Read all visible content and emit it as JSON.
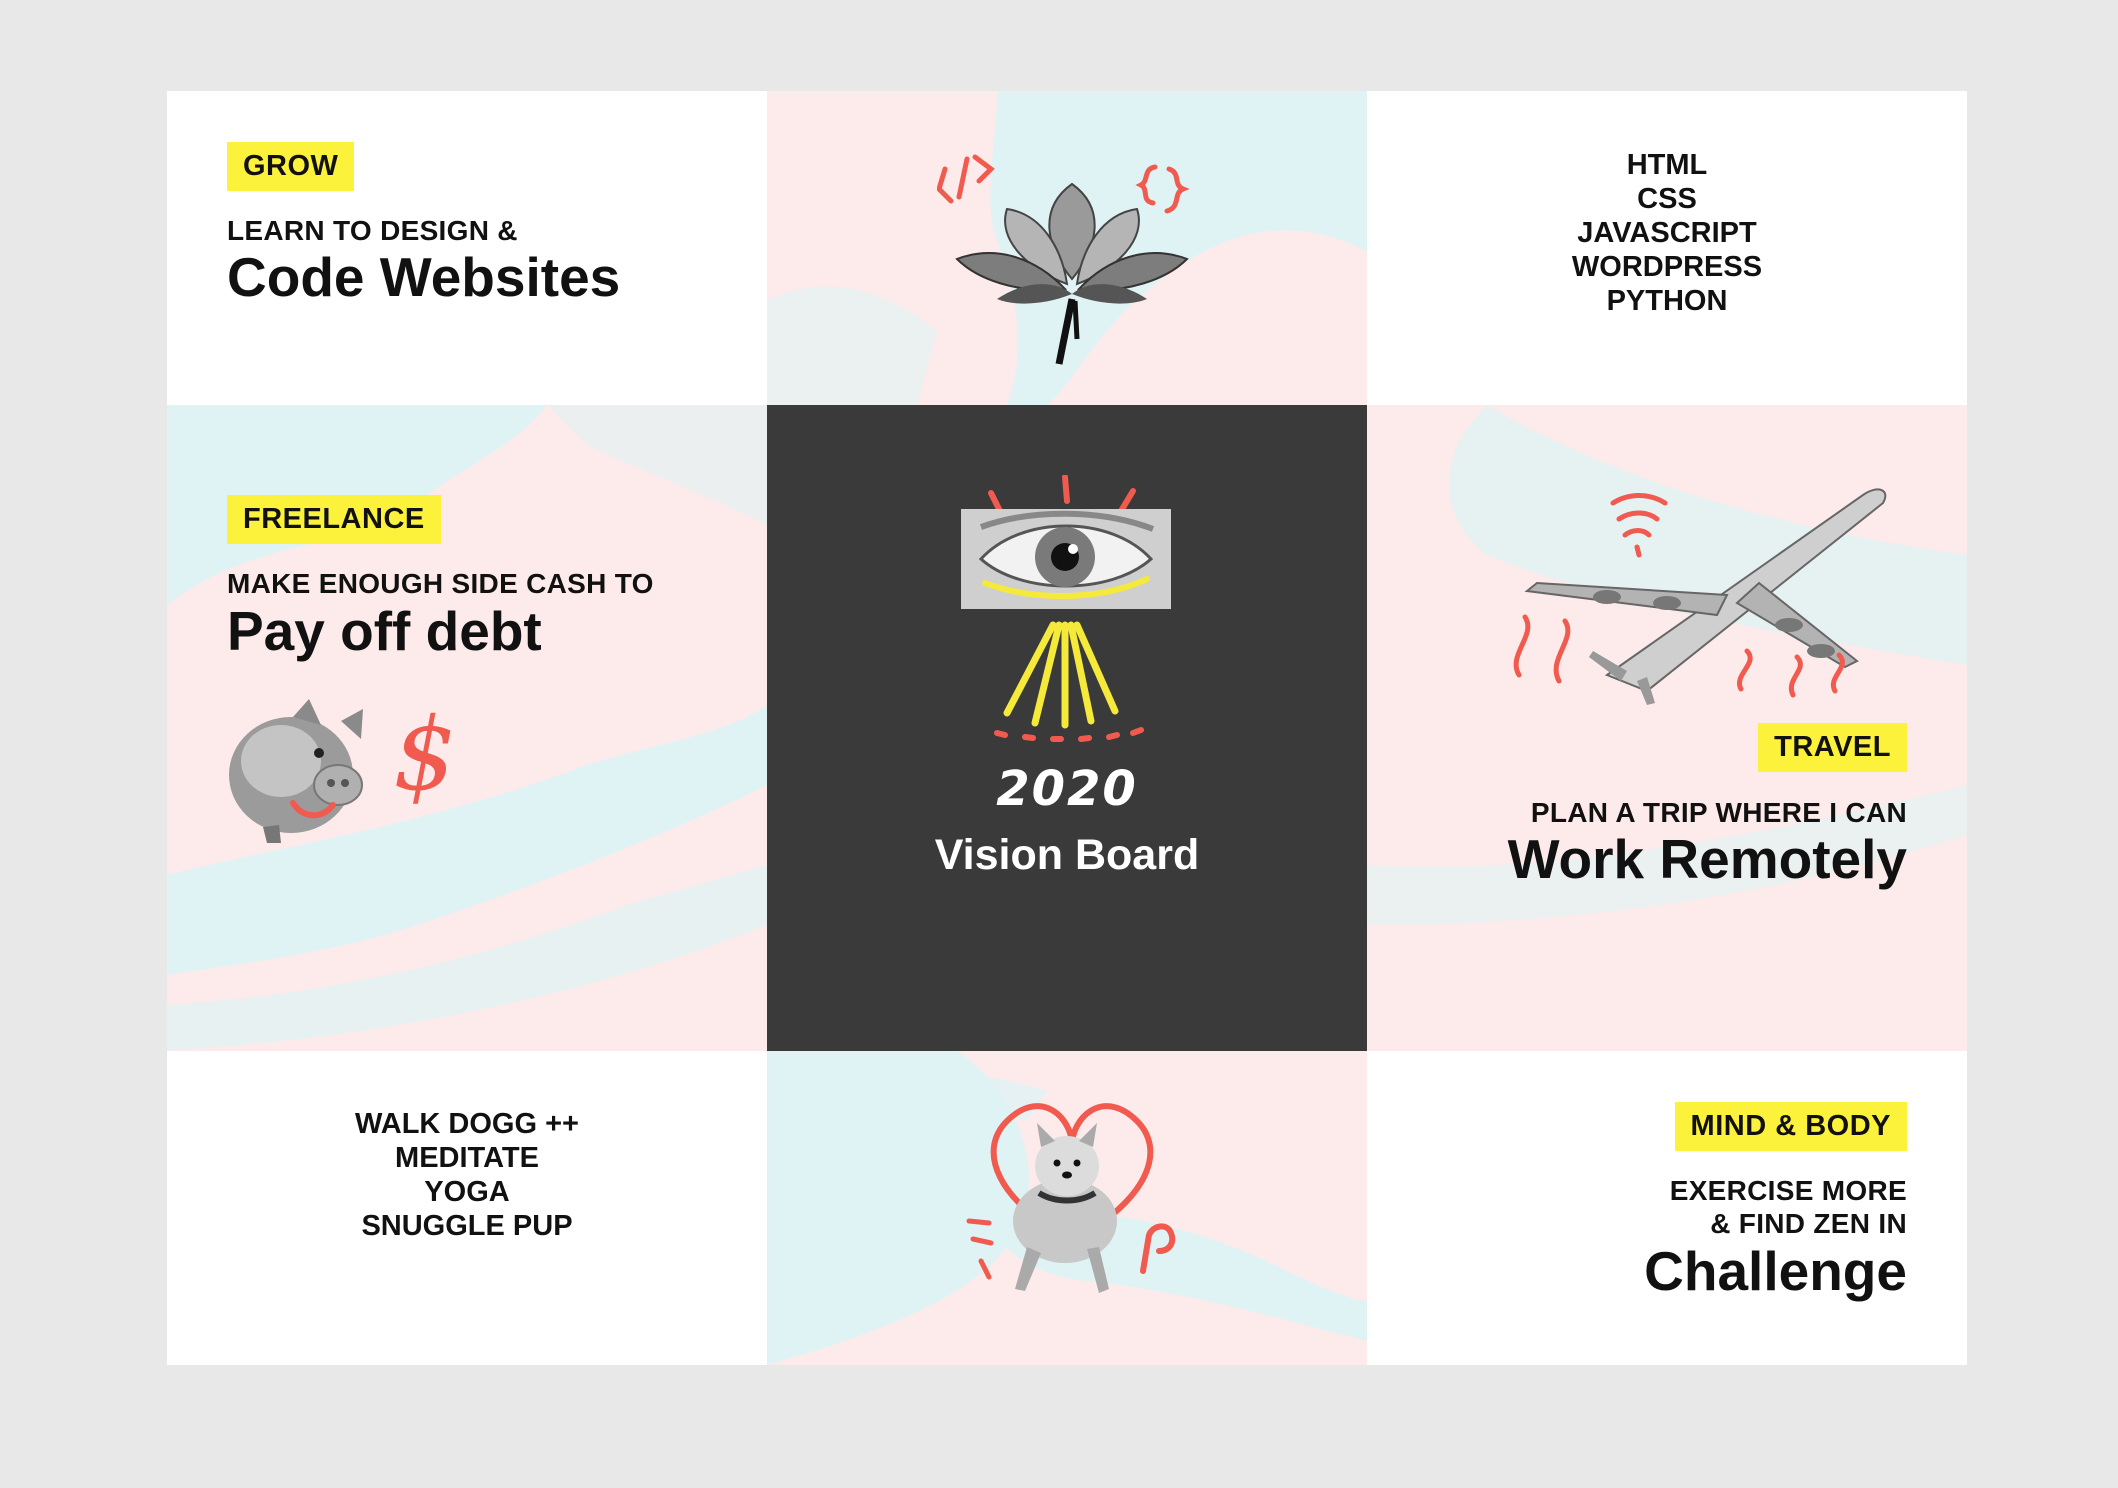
{
  "colors": {
    "page_bg": "#e8e8e8",
    "card_white": "#ffffff",
    "center_dark": "#3a3a3a",
    "pink": "#fcebea",
    "aqua": "#dff3f4",
    "tag_yellow": "#fdf23b",
    "doodle_red": "#f05a4f",
    "doodle_yellow": "#f5e93a"
  },
  "grow": {
    "tag": "GROW",
    "kicker": "LEARN TO DESIGN &",
    "headline": "Code Websites"
  },
  "code_art": {
    "icon": "lotus-flower-icon",
    "doodle_left": "</>",
    "doodle_right": "{}"
  },
  "skills": [
    "HTML",
    "CSS",
    "JAVASCRIPT",
    "WORDPRESS",
    "PYTHON"
  ],
  "freelance": {
    "tag": "FREELANCE",
    "kicker": "MAKE ENOUGH SIDE CASH TO",
    "headline": "Pay off debt",
    "icon": "piggy-bank-icon",
    "symbol": "$"
  },
  "center": {
    "icon": "eye-icon",
    "year": "2020",
    "title": "Vision Board"
  },
  "travel": {
    "tag": "TRAVEL",
    "kicker": "PLAN A TRIP WHERE I CAN",
    "headline": "Work Remotely",
    "icon": "airplane-icon"
  },
  "habits": [
    "WALK DOGG ++",
    "MEDITATE",
    "YOGA",
    "SNUGGLE PUP"
  ],
  "dog_art": {
    "icon": "dog-heart-icon"
  },
  "mind_body": {
    "tag": "MIND & BODY",
    "kicker_line1": "EXERCISE MORE",
    "kicker_line2": "& FIND ZEN IN",
    "headline": "Challenge"
  }
}
